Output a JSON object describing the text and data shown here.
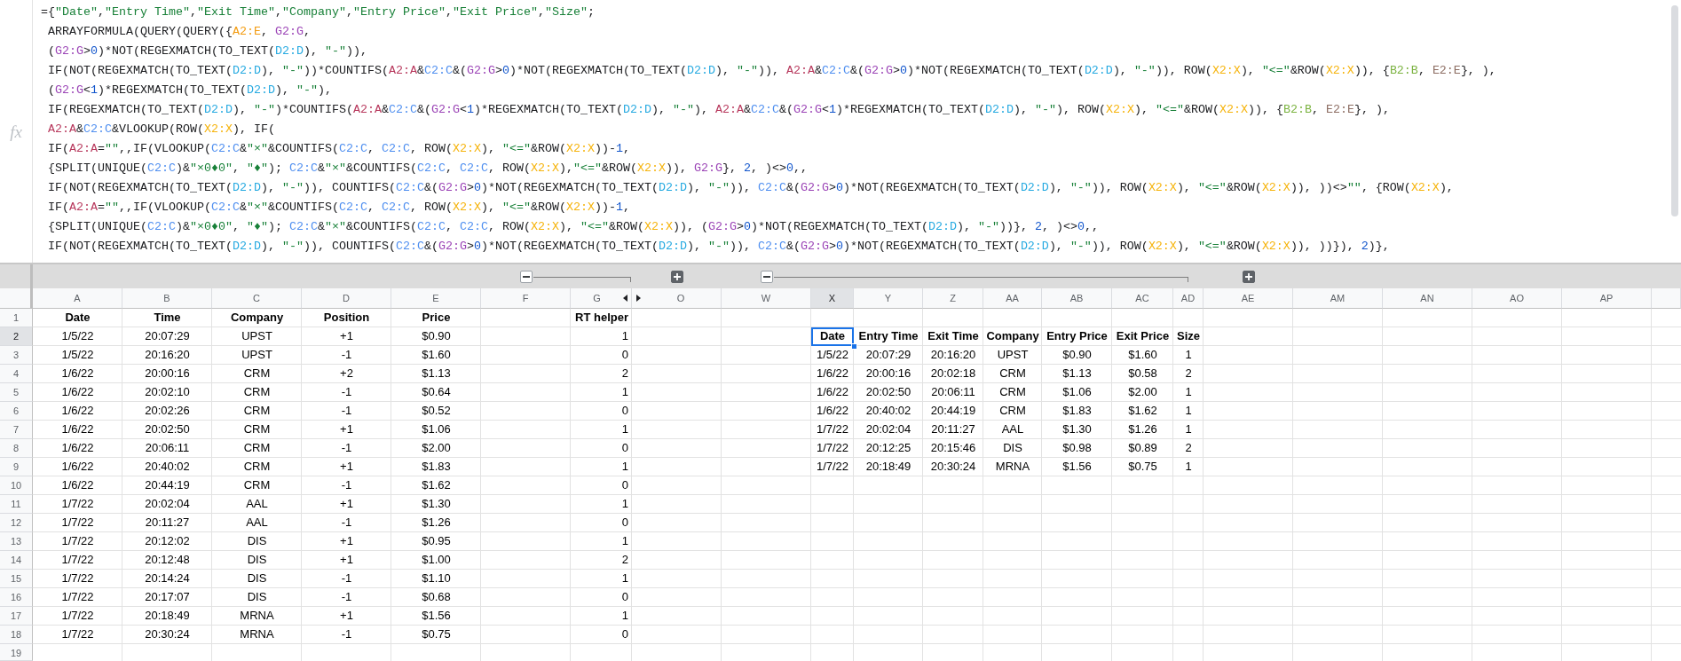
{
  "formula_bar": {
    "label": "fx",
    "lines": [
      {
        "segments": [
          {
            "text": "={"
          },
          {
            "text": "\"Date\"",
            "color": "#188038"
          },
          {
            "text": ","
          },
          {
            "text": "\"Entry Time\"",
            "color": "#188038"
          },
          {
            "text": ","
          },
          {
            "text": "\"Exit Time\"",
            "color": "#188038"
          },
          {
            "text": ","
          },
          {
            "text": "\"Company\"",
            "color": "#188038"
          },
          {
            "text": ","
          },
          {
            "text": "\"Entry Price\"",
            "color": "#188038"
          },
          {
            "text": ","
          },
          {
            "text": "\"Exit Price\"",
            "color": "#188038"
          },
          {
            "text": ","
          },
          {
            "text": "\"Size\"",
            "color": "#188038"
          },
          {
            "text": ";"
          }
        ]
      },
      {
        "segments": [
          {
            "text": " ARRAYFORMULA(QUERY(QUERY({"
          },
          {
            "text": "A2:E",
            "color": "#f39c12"
          },
          {
            "text": ", "
          },
          {
            "text": "G2:G",
            "color": "#9b44b6"
          },
          {
            "text": ","
          }
        ]
      },
      {
        "segments": [
          {
            "text": " ("
          },
          {
            "text": "G2:G",
            "color": "#9b44b6"
          },
          {
            "text": ">"
          },
          {
            "text": "0",
            "color": "#1155cc"
          },
          {
            "text": ")*NOT(REGEXMATCH(TO_TEXT("
          },
          {
            "text": "D2:D",
            "color": "#27aae1"
          },
          {
            "text": "), "
          },
          {
            "text": "\"-\"",
            "color": "#188038"
          },
          {
            "text": ")),"
          }
        ]
      },
      {
        "segments": [
          {
            "text": " IF(NOT(REGEXMATCH(TO_TEXT("
          },
          {
            "text": "D2:D",
            "color": "#27aae1"
          },
          {
            "text": "), "
          },
          {
            "text": "\"-\"",
            "color": "#188038"
          },
          {
            "text": "))*COUNTIFS("
          },
          {
            "text": "A2:A",
            "color": "#b83a5e"
          },
          {
            "text": "&"
          },
          {
            "text": "C2:C",
            "color": "#4f8ff0"
          },
          {
            "text": "&("
          },
          {
            "text": "G2:G",
            "color": "#9b44b6"
          },
          {
            "text": ">"
          },
          {
            "text": "0",
            "color": "#1155cc"
          },
          {
            "text": ")*NOT(REGEXMATCH(TO_TEXT("
          },
          {
            "text": "D2:D",
            "color": "#27aae1"
          },
          {
            "text": "), "
          },
          {
            "text": "\"-\"",
            "color": "#188038"
          },
          {
            "text": ")), "
          },
          {
            "text": "A2:A",
            "color": "#b83a5e"
          },
          {
            "text": "&"
          },
          {
            "text": "C2:C",
            "color": "#4f8ff0"
          },
          {
            "text": "&("
          },
          {
            "text": "G2:G",
            "color": "#9b44b6"
          },
          {
            "text": ">"
          },
          {
            "text": "0",
            "color": "#1155cc"
          },
          {
            "text": ")*NOT(REGEXMATCH(TO_TEXT("
          },
          {
            "text": "D2:D",
            "color": "#27aae1"
          },
          {
            "text": "), "
          },
          {
            "text": "\"-\"",
            "color": "#188038"
          },
          {
            "text": ")), ROW("
          },
          {
            "text": "X2:X",
            "color": "#f6b40e"
          },
          {
            "text": "), "
          },
          {
            "text": "\"<=\"",
            "color": "#188038"
          },
          {
            "text": "&ROW("
          },
          {
            "text": "X2:X",
            "color": "#f6b40e"
          },
          {
            "text": ")), {"
          },
          {
            "text": "B2:B",
            "color": "#7cb342"
          },
          {
            "text": ", "
          },
          {
            "text": "E2:E",
            "color": "#8d6e63"
          },
          {
            "text": "}, ),"
          }
        ]
      },
      {
        "segments": [
          {
            "text": " ("
          },
          {
            "text": "G2:G",
            "color": "#9b44b6"
          },
          {
            "text": "<"
          },
          {
            "text": "1",
            "color": "#1155cc"
          },
          {
            "text": ")*REGEXMATCH(TO_TEXT("
          },
          {
            "text": "D2:D",
            "color": "#27aae1"
          },
          {
            "text": "), "
          },
          {
            "text": "\"-\"",
            "color": "#188038"
          },
          {
            "text": "),"
          }
        ]
      },
      {
        "segments": [
          {
            "text": " IF(REGEXMATCH(TO_TEXT("
          },
          {
            "text": "D2:D",
            "color": "#27aae1"
          },
          {
            "text": "), "
          },
          {
            "text": "\"-\"",
            "color": "#188038"
          },
          {
            "text": ")*COUNTIFS("
          },
          {
            "text": "A2:A",
            "color": "#b83a5e"
          },
          {
            "text": "&"
          },
          {
            "text": "C2:C",
            "color": "#4f8ff0"
          },
          {
            "text": "&("
          },
          {
            "text": "G2:G",
            "color": "#9b44b6"
          },
          {
            "text": "<"
          },
          {
            "text": "1",
            "color": "#1155cc"
          },
          {
            "text": ")*REGEXMATCH(TO_TEXT("
          },
          {
            "text": "D2:D",
            "color": "#27aae1"
          },
          {
            "text": "), "
          },
          {
            "text": "\"-\"",
            "color": "#188038"
          },
          {
            "text": "), "
          },
          {
            "text": "A2:A",
            "color": "#b83a5e"
          },
          {
            "text": "&"
          },
          {
            "text": "C2:C",
            "color": "#4f8ff0"
          },
          {
            "text": "&("
          },
          {
            "text": "G2:G",
            "color": "#9b44b6"
          },
          {
            "text": "<"
          },
          {
            "text": "1",
            "color": "#1155cc"
          },
          {
            "text": ")*REGEXMATCH(TO_TEXT("
          },
          {
            "text": "D2:D",
            "color": "#27aae1"
          },
          {
            "text": "), "
          },
          {
            "text": "\"-\"",
            "color": "#188038"
          },
          {
            "text": "), ROW("
          },
          {
            "text": "X2:X",
            "color": "#f6b40e"
          },
          {
            "text": "), "
          },
          {
            "text": "\"<=\"",
            "color": "#188038"
          },
          {
            "text": "&ROW("
          },
          {
            "text": "X2:X",
            "color": "#f6b40e"
          },
          {
            "text": ")), {"
          },
          {
            "text": "B2:B",
            "color": "#7cb342"
          },
          {
            "text": ", "
          },
          {
            "text": "E2:E",
            "color": "#8d6e63"
          },
          {
            "text": "}, ),"
          }
        ]
      },
      {
        "segments": [
          {
            "text": " A2:A",
            "color": "#b83a5e"
          },
          {
            "text": "&"
          },
          {
            "text": "C2:C",
            "color": "#4f8ff0"
          },
          {
            "text": "&VLOOKUP(ROW("
          },
          {
            "text": "X2:X",
            "color": "#f6b40e"
          },
          {
            "text": "), IF("
          }
        ]
      },
      {
        "segments": [
          {
            "text": " IF("
          },
          {
            "text": "A2:A",
            "color": "#b83a5e"
          },
          {
            "text": "="
          },
          {
            "text": "\"\"",
            "color": "#188038"
          },
          {
            "text": ",,IF(VLOOKUP("
          },
          {
            "text": "C2:C",
            "color": "#4f8ff0"
          },
          {
            "text": "&"
          },
          {
            "text": "\"×\"",
            "color": "#188038"
          },
          {
            "text": "&COUNTIFS("
          },
          {
            "text": "C2:C",
            "color": "#4f8ff0"
          },
          {
            "text": ", "
          },
          {
            "text": "C2:C",
            "color": "#4f8ff0"
          },
          {
            "text": ", ROW("
          },
          {
            "text": "X2:X",
            "color": "#f6b40e"
          },
          {
            "text": "), "
          },
          {
            "text": "\"<=\"",
            "color": "#188038"
          },
          {
            "text": "&ROW("
          },
          {
            "text": "X2:X",
            "color": "#f6b40e"
          },
          {
            "text": "))-"
          },
          {
            "text": "1",
            "color": "#1155cc"
          },
          {
            "text": ","
          }
        ]
      },
      {
        "segments": [
          {
            "text": " {SPLIT(UNIQUE("
          },
          {
            "text": "C2:C",
            "color": "#4f8ff0"
          },
          {
            "text": ")&"
          },
          {
            "text": "\"×0♦0\"",
            "color": "#188038"
          },
          {
            "text": ", "
          },
          {
            "text": "\"♦\"",
            "color": "#188038"
          },
          {
            "text": "); "
          },
          {
            "text": "C2:C",
            "color": "#4f8ff0"
          },
          {
            "text": "&"
          },
          {
            "text": "\"×\"",
            "color": "#188038"
          },
          {
            "text": "&COUNTIFS("
          },
          {
            "text": "C2:C",
            "color": "#4f8ff0"
          },
          {
            "text": ", "
          },
          {
            "text": "C2:C",
            "color": "#4f8ff0"
          },
          {
            "text": ", ROW("
          },
          {
            "text": "X2:X",
            "color": "#f6b40e"
          },
          {
            "text": "),"
          },
          {
            "text": "\"<=\"",
            "color": "#188038"
          },
          {
            "text": "&ROW("
          },
          {
            "text": "X2:X",
            "color": "#f6b40e"
          },
          {
            "text": ")), "
          },
          {
            "text": "G2:G",
            "color": "#9b44b6"
          },
          {
            "text": "}, "
          },
          {
            "text": "2",
            "color": "#1155cc"
          },
          {
            "text": ", )<>"
          },
          {
            "text": "0",
            "color": "#1155cc"
          },
          {
            "text": ",,"
          }
        ]
      },
      {
        "segments": [
          {
            "text": " IF(NOT(REGEXMATCH(TO_TEXT("
          },
          {
            "text": "D2:D",
            "color": "#27aae1"
          },
          {
            "text": "), "
          },
          {
            "text": "\"-\"",
            "color": "#188038"
          },
          {
            "text": ")), COUNTIFS("
          },
          {
            "text": "C2:C",
            "color": "#4f8ff0"
          },
          {
            "text": "&("
          },
          {
            "text": "G2:G",
            "color": "#9b44b6"
          },
          {
            "text": ">"
          },
          {
            "text": "0",
            "color": "#1155cc"
          },
          {
            "text": ")*NOT(REGEXMATCH(TO_TEXT("
          },
          {
            "text": "D2:D",
            "color": "#27aae1"
          },
          {
            "text": "), "
          },
          {
            "text": "\"-\"",
            "color": "#188038"
          },
          {
            "text": ")), "
          },
          {
            "text": "C2:C",
            "color": "#4f8ff0"
          },
          {
            "text": "&("
          },
          {
            "text": "G2:G",
            "color": "#9b44b6"
          },
          {
            "text": ">"
          },
          {
            "text": "0",
            "color": "#1155cc"
          },
          {
            "text": ")*NOT(REGEXMATCH(TO_TEXT("
          },
          {
            "text": "D2:D",
            "color": "#27aae1"
          },
          {
            "text": "), "
          },
          {
            "text": "\"-\"",
            "color": "#188038"
          },
          {
            "text": ")), ROW("
          },
          {
            "text": "X2:X",
            "color": "#f6b40e"
          },
          {
            "text": "), "
          },
          {
            "text": "\"<=\"",
            "color": "#188038"
          },
          {
            "text": "&ROW("
          },
          {
            "text": "X2:X",
            "color": "#f6b40e"
          },
          {
            "text": ")), ))<>"
          },
          {
            "text": "\"\"",
            "color": "#188038"
          },
          {
            "text": ", {ROW("
          },
          {
            "text": "X2:X",
            "color": "#f6b40e"
          },
          {
            "text": "),"
          }
        ]
      },
      {
        "segments": [
          {
            "text": " IF("
          },
          {
            "text": "A2:A",
            "color": "#b83a5e"
          },
          {
            "text": "="
          },
          {
            "text": "\"\"",
            "color": "#188038"
          },
          {
            "text": ",,IF(VLOOKUP("
          },
          {
            "text": "C2:C",
            "color": "#4f8ff0"
          },
          {
            "text": "&"
          },
          {
            "text": "\"×\"",
            "color": "#188038"
          },
          {
            "text": "&COUNTIFS("
          },
          {
            "text": "C2:C",
            "color": "#4f8ff0"
          },
          {
            "text": ", "
          },
          {
            "text": "C2:C",
            "color": "#4f8ff0"
          },
          {
            "text": ", ROW("
          },
          {
            "text": "X2:X",
            "color": "#f6b40e"
          },
          {
            "text": "), "
          },
          {
            "text": "\"<=\"",
            "color": "#188038"
          },
          {
            "text": "&ROW("
          },
          {
            "text": "X2:X",
            "color": "#f6b40e"
          },
          {
            "text": "))-"
          },
          {
            "text": "1",
            "color": "#1155cc"
          },
          {
            "text": ","
          }
        ]
      },
      {
        "segments": [
          {
            "text": " {SPLIT(UNIQUE("
          },
          {
            "text": "C2:C",
            "color": "#4f8ff0"
          },
          {
            "text": ")&"
          },
          {
            "text": "\"×0♦0\"",
            "color": "#188038"
          },
          {
            "text": ", "
          },
          {
            "text": "\"♦\"",
            "color": "#188038"
          },
          {
            "text": "); "
          },
          {
            "text": "C2:C",
            "color": "#4f8ff0"
          },
          {
            "text": "&"
          },
          {
            "text": "\"×\"",
            "color": "#188038"
          },
          {
            "text": "&COUNTIFS("
          },
          {
            "text": "C2:C",
            "color": "#4f8ff0"
          },
          {
            "text": ", "
          },
          {
            "text": "C2:C",
            "color": "#4f8ff0"
          },
          {
            "text": ", ROW("
          },
          {
            "text": "X2:X",
            "color": "#f6b40e"
          },
          {
            "text": "), "
          },
          {
            "text": "\"<=\"",
            "color": "#188038"
          },
          {
            "text": "&ROW("
          },
          {
            "text": "X2:X",
            "color": "#f6b40e"
          },
          {
            "text": ")), ("
          },
          {
            "text": "G2:G",
            "color": "#9b44b6"
          },
          {
            "text": ">"
          },
          {
            "text": "0",
            "color": "#1155cc"
          },
          {
            "text": ")*NOT(REGEXMATCH(TO_TEXT("
          },
          {
            "text": "D2:D",
            "color": "#27aae1"
          },
          {
            "text": "), "
          },
          {
            "text": "\"-\"",
            "color": "#188038"
          },
          {
            "text": "))}, "
          },
          {
            "text": "2",
            "color": "#1155cc"
          },
          {
            "text": ", )<>"
          },
          {
            "text": "0",
            "color": "#1155cc"
          },
          {
            "text": ",,"
          }
        ]
      },
      {
        "segments": [
          {
            "text": " IF(NOT(REGEXMATCH(TO_TEXT("
          },
          {
            "text": "D2:D",
            "color": "#27aae1"
          },
          {
            "text": "), "
          },
          {
            "text": "\"-\"",
            "color": "#188038"
          },
          {
            "text": ")), COUNTIFS("
          },
          {
            "text": "C2:C",
            "color": "#4f8ff0"
          },
          {
            "text": "&("
          },
          {
            "text": "G2:G",
            "color": "#9b44b6"
          },
          {
            "text": ">"
          },
          {
            "text": "0",
            "color": "#1155cc"
          },
          {
            "text": ")*NOT(REGEXMATCH(TO_TEXT("
          },
          {
            "text": "D2:D",
            "color": "#27aae1"
          },
          {
            "text": "), "
          },
          {
            "text": "\"-\"",
            "color": "#188038"
          },
          {
            "text": ")), "
          },
          {
            "text": "C2:C",
            "color": "#4f8ff0"
          },
          {
            "text": "&("
          },
          {
            "text": "G2:G",
            "color": "#9b44b6"
          },
          {
            "text": ">"
          },
          {
            "text": "0",
            "color": "#1155cc"
          },
          {
            "text": ")*NOT(REGEXMATCH(TO_TEXT("
          },
          {
            "text": "D2:D",
            "color": "#27aae1"
          },
          {
            "text": "), "
          },
          {
            "text": "\"-\"",
            "color": "#188038"
          },
          {
            "text": ")), ROW("
          },
          {
            "text": "X2:X",
            "color": "#f6b40e"
          },
          {
            "text": "), "
          },
          {
            "text": "\"<=\"",
            "color": "#188038"
          },
          {
            "text": "&ROW("
          },
          {
            "text": "X2:X",
            "color": "#f6b40e"
          },
          {
            "text": ")), ))}), "
          },
          {
            "text": "2",
            "color": "#1155cc"
          },
          {
            "text": ")},"
          }
        ]
      }
    ]
  },
  "column_groups": [
    {
      "expanded": true
    },
    {
      "expanded": false
    },
    {
      "expanded": true
    },
    {
      "expanded": false
    }
  ],
  "columns": [
    {
      "label": "A",
      "selected": false,
      "hidden_before": false,
      "hidden_after": false
    },
    {
      "label": "B",
      "selected": false,
      "hidden_before": false,
      "hidden_after": false
    },
    {
      "label": "C",
      "selected": false,
      "hidden_before": false,
      "hidden_after": false
    },
    {
      "label": "D",
      "selected": false,
      "hidden_before": false,
      "hidden_after": false
    },
    {
      "label": "E",
      "selected": false,
      "hidden_before": false,
      "hidden_after": false
    },
    {
      "label": "F",
      "selected": false,
      "hidden_before": false,
      "hidden_after": false
    },
    {
      "label": "G",
      "selected": false,
      "hidden_before": false,
      "hidden_after": true
    },
    {
      "label": "O",
      "selected": false,
      "hidden_before": true,
      "hidden_after": false
    },
    {
      "label": "W",
      "selected": false,
      "hidden_before": false,
      "hidden_after": false
    },
    {
      "label": "X",
      "selected": true,
      "hidden_before": false,
      "hidden_after": false
    },
    {
      "label": "Y",
      "selected": false,
      "hidden_before": false,
      "hidden_after": false
    },
    {
      "label": "Z",
      "selected": false,
      "hidden_before": false,
      "hidden_after": false
    },
    {
      "label": "AA",
      "selected": false,
      "hidden_before": false,
      "hidden_after": false
    },
    {
      "label": "AB",
      "selected": false,
      "hidden_before": false,
      "hidden_after": false
    },
    {
      "label": "AC",
      "selected": false,
      "hidden_before": false,
      "hidden_after": false
    },
    {
      "label": "AD",
      "selected": false,
      "hidden_before": false,
      "hidden_after": false
    },
    {
      "label": "AE",
      "selected": false,
      "hidden_before": false,
      "hidden_after": false
    },
    {
      "label": "AM",
      "selected": false,
      "hidden_before": false,
      "hidden_after": false
    },
    {
      "label": "AN",
      "selected": false,
      "hidden_before": false,
      "hidden_after": false
    },
    {
      "label": "AO",
      "selected": false,
      "hidden_before": false,
      "hidden_after": false
    },
    {
      "label": "AP",
      "selected": false,
      "hidden_before": false,
      "hidden_after": false
    }
  ],
  "rows": [
    {
      "number": "1",
      "selected": false
    },
    {
      "number": "2",
      "selected": true
    },
    {
      "number": "3",
      "selected": false
    },
    {
      "number": "4",
      "selected": false
    },
    {
      "number": "5",
      "selected": false
    },
    {
      "number": "6",
      "selected": false
    },
    {
      "number": "7",
      "selected": false
    },
    {
      "number": "8",
      "selected": false
    },
    {
      "number": "9",
      "selected": false
    },
    {
      "number": "10",
      "selected": false
    },
    {
      "number": "11",
      "selected": false
    },
    {
      "number": "12",
      "selected": false
    },
    {
      "number": "13",
      "selected": false
    },
    {
      "number": "14",
      "selected": false
    },
    {
      "number": "15",
      "selected": false
    },
    {
      "number": "16",
      "selected": false
    },
    {
      "number": "17",
      "selected": false
    },
    {
      "number": "18",
      "selected": false
    },
    {
      "number": "19",
      "selected": false
    }
  ],
  "trade_log": {
    "headers": [
      "Date",
      "Time",
      "Company",
      "Position",
      "Price",
      "RT helper"
    ],
    "rows": [
      [
        "1/5/22",
        "20:07:29",
        "UPST",
        "+1",
        "$0.90",
        "1"
      ],
      [
        "1/5/22",
        "20:16:20",
        "UPST",
        "-1",
        "$1.60",
        "0"
      ],
      [
        "1/6/22",
        "20:00:16",
        "CRM",
        "+2",
        "$1.13",
        "2"
      ],
      [
        "1/6/22",
        "20:02:10",
        "CRM",
        "-1",
        "$0.64",
        "1"
      ],
      [
        "1/6/22",
        "20:02:26",
        "CRM",
        "-1",
        "$0.52",
        "0"
      ],
      [
        "1/6/22",
        "20:02:50",
        "CRM",
        "+1",
        "$1.06",
        "1"
      ],
      [
        "1/6/22",
        "20:06:11",
        "CRM",
        "-1",
        "$2.00",
        "0"
      ],
      [
        "1/6/22",
        "20:40:02",
        "CRM",
        "+1",
        "$1.83",
        "1"
      ],
      [
        "1/6/22",
        "20:44:19",
        "CRM",
        "-1",
        "$1.62",
        "0"
      ],
      [
        "1/7/22",
        "20:02:04",
        "AAL",
        "+1",
        "$1.30",
        "1"
      ],
      [
        "1/7/22",
        "20:11:27",
        "AAL",
        "-1",
        "$1.26",
        "0"
      ],
      [
        "1/7/22",
        "20:12:02",
        "DIS",
        "+1",
        "$0.95",
        "1"
      ],
      [
        "1/7/22",
        "20:12:48",
        "DIS",
        "+1",
        "$1.00",
        "2"
      ],
      [
        "1/7/22",
        "20:14:24",
        "DIS",
        "-1",
        "$1.10",
        "1"
      ],
      [
        "1/7/22",
        "20:17:07",
        "DIS",
        "-1",
        "$0.68",
        "0"
      ],
      [
        "1/7/22",
        "20:18:49",
        "MRNA",
        "+1",
        "$1.56",
        "1"
      ],
      [
        "1/7/22",
        "20:30:24",
        "MRNA",
        "-1",
        "$0.75",
        "0"
      ]
    ]
  },
  "result_table": {
    "headers": [
      "Date",
      "Entry Time",
      "Exit Time",
      "Company",
      "Entry Price",
      "Exit Price",
      "Size"
    ],
    "rows": [
      [
        "1/5/22",
        "20:07:29",
        "20:16:20",
        "UPST",
        "$0.90",
        "$1.60",
        "1"
      ],
      [
        "1/6/22",
        "20:00:16",
        "20:02:18",
        "CRM",
        "$1.13",
        "$0.58",
        "2"
      ],
      [
        "1/6/22",
        "20:02:50",
        "20:06:11",
        "CRM",
        "$1.06",
        "$2.00",
        "1"
      ],
      [
        "1/6/22",
        "20:40:02",
        "20:44:19",
        "CRM",
        "$1.83",
        "$1.62",
        "1"
      ],
      [
        "1/7/22",
        "20:02:04",
        "20:11:27",
        "AAL",
        "$1.30",
        "$1.26",
        "1"
      ],
      [
        "1/7/22",
        "20:12:25",
        "20:15:46",
        "DIS",
        "$0.98",
        "$0.89",
        "2"
      ],
      [
        "1/7/22",
        "20:18:49",
        "20:30:24",
        "MRNA",
        "$1.56",
        "$0.75",
        "1"
      ]
    ]
  }
}
